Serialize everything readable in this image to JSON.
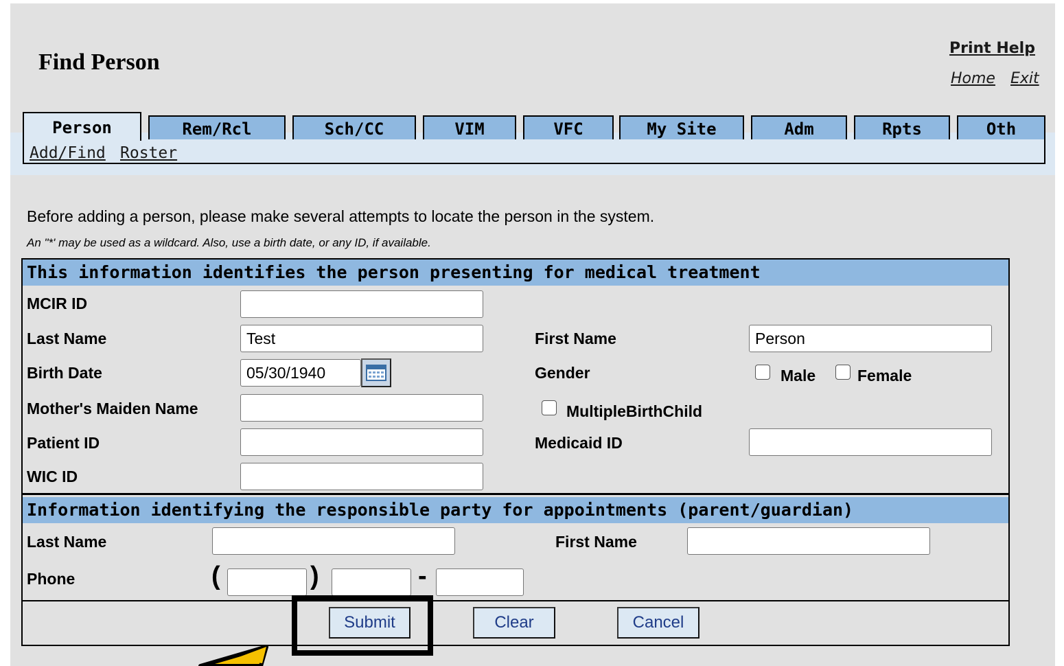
{
  "header": {
    "title": "Find Person",
    "print_help": "Print Help",
    "home": "Home",
    "exit": "Exit"
  },
  "tabs": [
    {
      "label": "Person",
      "active": true
    },
    {
      "label": "Rem/Rcl"
    },
    {
      "label": "Sch/CC"
    },
    {
      "label": "VIM"
    },
    {
      "label": "VFC"
    },
    {
      "label": "My Site"
    },
    {
      "label": "Adm"
    },
    {
      "label": "Rpts"
    },
    {
      "label": "Oth"
    }
  ],
  "subnav": {
    "add_find": "Add/Find",
    "roster": "Roster"
  },
  "intro": "Before adding a person, please make several attempts to locate the person in the system.",
  "note": "An \"*' may be used as a wildcard. Also, use a birth date, or any ID, if available.",
  "person_section": {
    "heading": "This information identifies the person presenting for medical treatment",
    "mcir_id": {
      "label": "MCIR ID",
      "value": ""
    },
    "last_name": {
      "label": "Last Name",
      "value": "Test"
    },
    "first_name": {
      "label": "First Name",
      "value": "Person"
    },
    "birth_date": {
      "label": "Birth Date",
      "value": "05/30/1940"
    },
    "gender": {
      "label": "Gender",
      "male": "Male",
      "female": "Female"
    },
    "mothers_maiden": {
      "label": "Mother's Maiden Name",
      "value": ""
    },
    "multiple_birth": {
      "label": "MultipleBirthChild"
    },
    "patient_id": {
      "label": "Patient ID",
      "value": ""
    },
    "medicaid_id": {
      "label": "Medicaid ID",
      "value": ""
    },
    "wic_id": {
      "label": "WIC ID",
      "value": ""
    }
  },
  "guardian_section": {
    "heading": "Information identifying the responsible party for appointments (parent/guardian)",
    "last_name": {
      "label": "Last Name",
      "value": ""
    },
    "first_name": {
      "label": "First Name",
      "value": ""
    },
    "phone": {
      "label": "Phone",
      "open_paren": "(",
      "close_paren": ")",
      "dash": "-"
    }
  },
  "buttons": {
    "submit": "Submit",
    "clear": "Clear",
    "cancel": "Cancel"
  },
  "colors": {
    "background": "#e1e1e1",
    "tab": "#8fb8e0",
    "tab_active": "#dce8f3",
    "section_header": "#8fb8e0",
    "button_text": "#1f3c88",
    "arrow": "#f5c000"
  },
  "icons": {
    "calendar": "calendar-icon",
    "arrow": "pointer-arrow-icon"
  }
}
